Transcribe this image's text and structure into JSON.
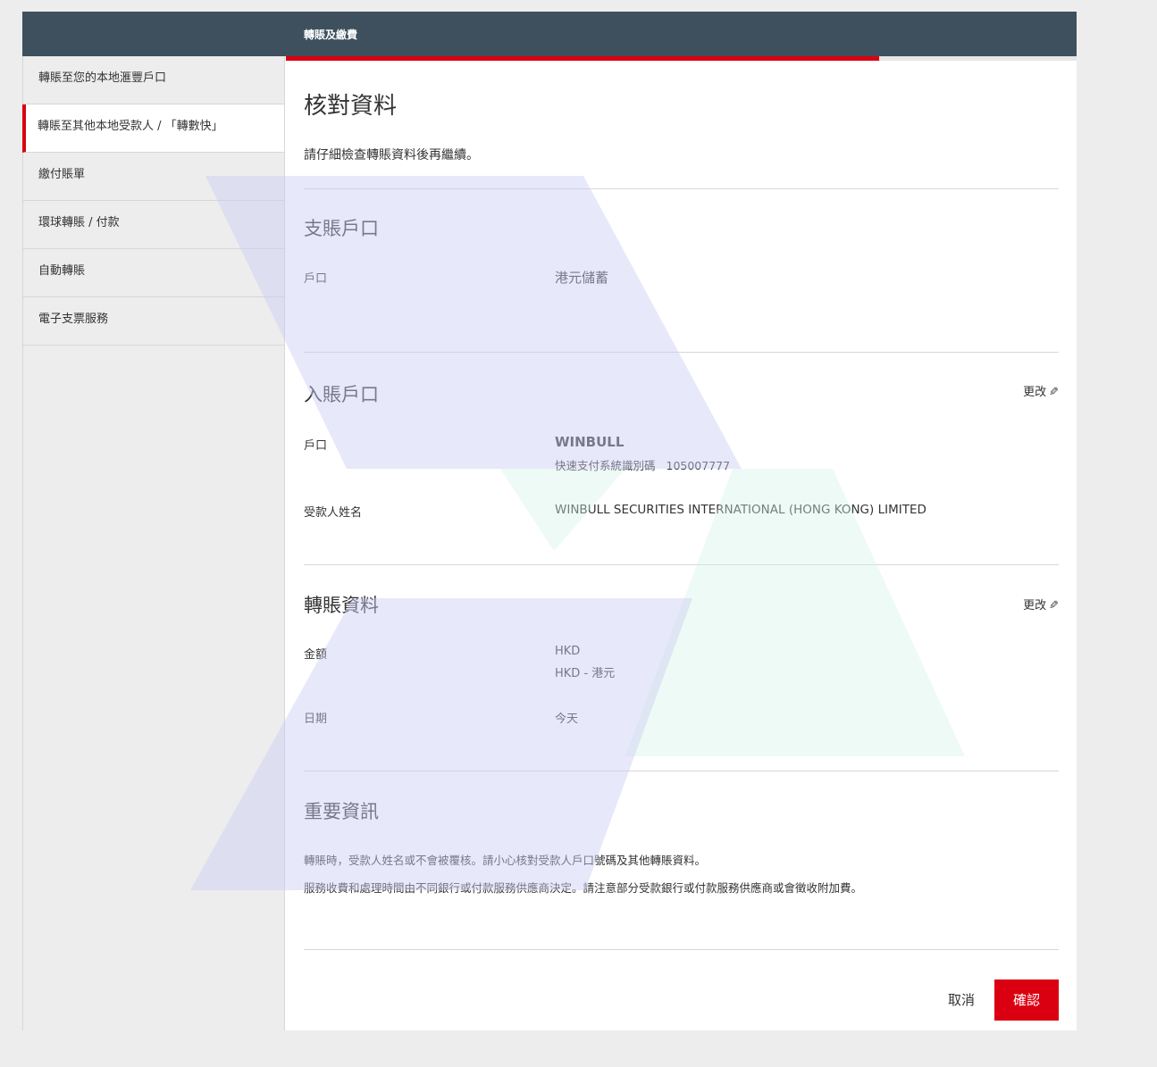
{
  "header": {
    "title": "轉賬及繳費"
  },
  "progress": {
    "fraction": 0.75
  },
  "sidebar": {
    "items": [
      {
        "label": "轉賬至您的本地滙豐戶口"
      },
      {
        "label": "轉賬至其他本地受款人 / 「轉數快」"
      },
      {
        "label": "繳付賬單"
      },
      {
        "label": "環球轉賬 / 付款"
      },
      {
        "label": "自動轉賬"
      },
      {
        "label": "電子支票服務"
      }
    ],
    "active_index": 1
  },
  "main": {
    "title": "核對資料",
    "intro": "請仔細檢查轉賬資料後再繼續。",
    "from_account": {
      "heading": "支賬戶口",
      "account_label": "戶口",
      "account_value": "港元儲蓄"
    },
    "to_account": {
      "heading": "入賬戶口",
      "edit_label": "更改",
      "account_label": "戶口",
      "account_name": "WINBULL",
      "fps_label": "快速支付系統識別碼",
      "fps_id": "105007777",
      "payee_label": "受款人姓名",
      "payee_value": "WINBULL SECURITIES INTERNATIONAL (HONG KONG) LIMITED"
    },
    "transfer_details": {
      "heading": "轉賬資料",
      "edit_label": "更改",
      "amount_label": "金額",
      "amount_value": "HKD",
      "currency_value": "HKD - 港元",
      "date_label": "日期",
      "date_value": "今天"
    },
    "important": {
      "heading": "重要資訊",
      "line1": "轉賬時，受款人姓名或不會被覆核。請小心核對受款人戶口號碼及其他轉賬資料。",
      "line2": "服務收費和處理時間由不同銀行或付款服務供應商決定。請注意部分受款銀行或付款服務供應商或會徵收附加費。"
    },
    "buttons": {
      "cancel": "取消",
      "confirm": "確認"
    }
  },
  "colors": {
    "header_bg": "#3e505d",
    "accent_red": "#db0011"
  },
  "icons": {
    "edit": "pencil-icon"
  }
}
